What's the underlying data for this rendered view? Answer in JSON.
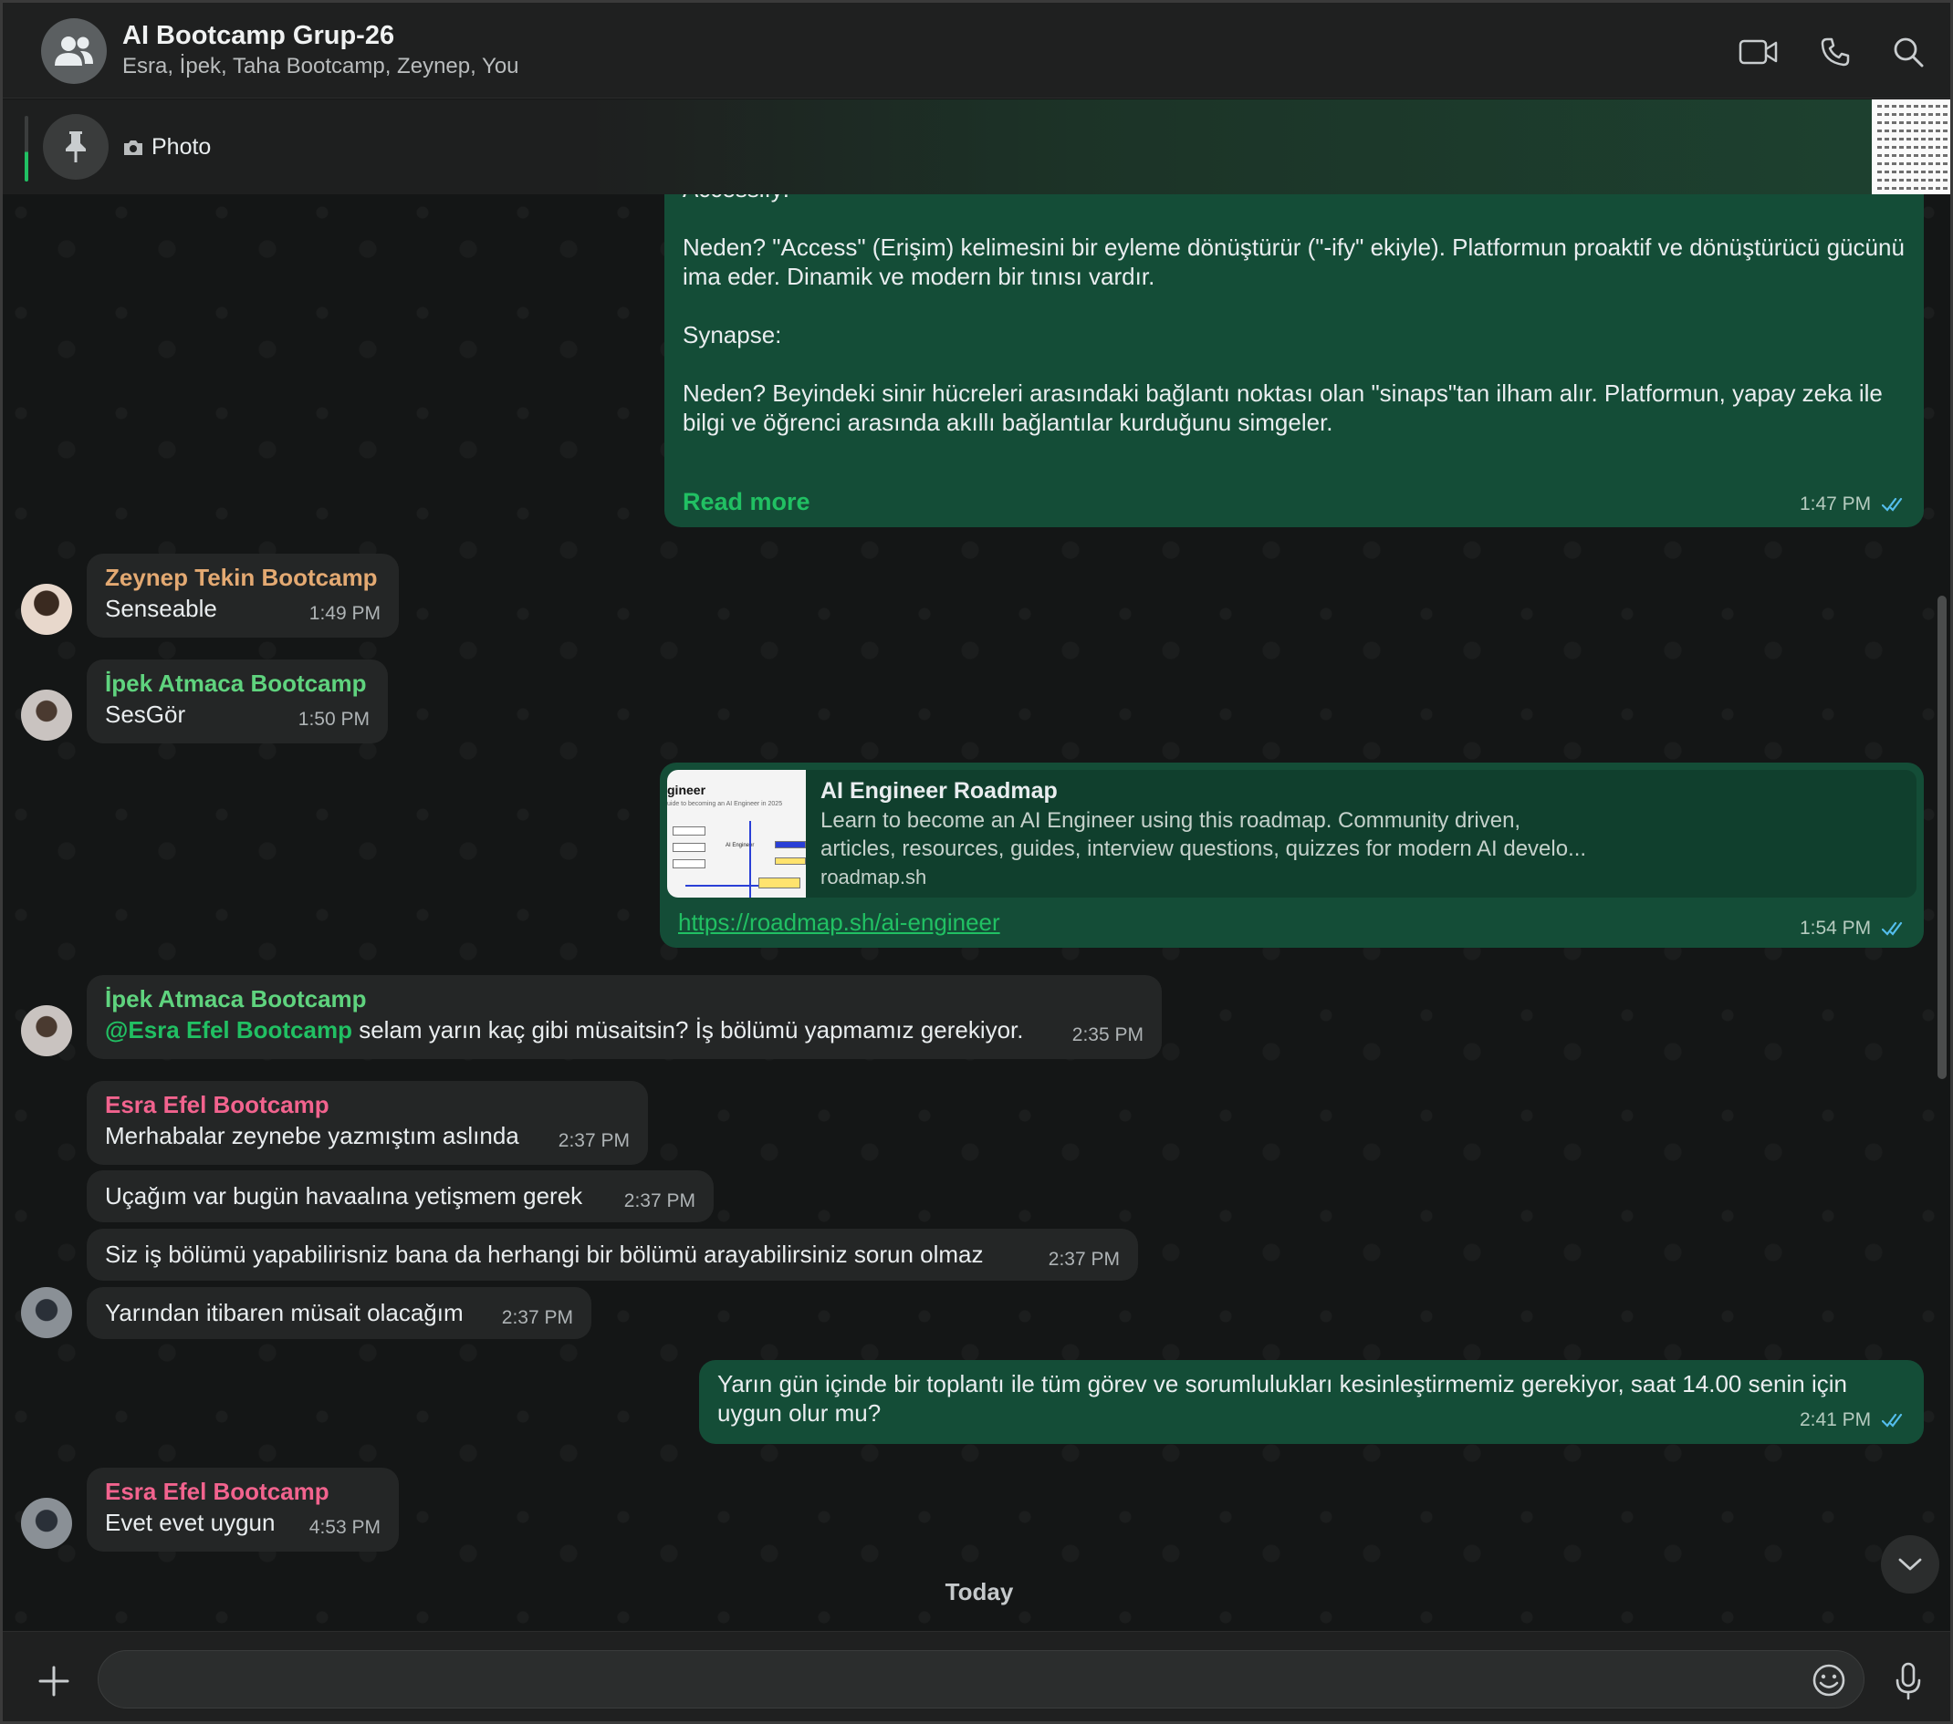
{
  "header": {
    "title": "AI Bootcamp Grup-26",
    "members": "Esra, İpek, Taha Bootcamp, Zeynep, You"
  },
  "pinned": {
    "label": "Photo"
  },
  "messages": {
    "m1": {
      "cut_line": "Accessify:",
      "p1": "Neden? \"Access\" (Erişim) kelimesini bir eyleme dönüştürür (\"-ify\" ekiyle). Platformun proaktif ve dönüştürücü gücünü ima eder. Dinamik ve modern bir tınısı vardır.",
      "p2": "Synapse:",
      "p3": "Neden? Beyindeki sinir hücreleri arasındaki bağlantı noktası olan \"sinaps\"tan ilham alır. Platformun, yapay zeka ile bilgi ve öğrenci arasında akıllı bağlantılar kurduğunu simgeler.",
      "read_more": "Read more",
      "time": "1:47 PM"
    },
    "m2": {
      "sender": "Zeynep Tekin Bootcamp",
      "text": "Senseable",
      "time": "1:49 PM"
    },
    "m3": {
      "sender": "İpek Atmaca Bootcamp",
      "text": "SesGör",
      "time": "1:50 PM"
    },
    "m4": {
      "thumb_title": "gineer",
      "thumb_sub": "uide to becoming an AI Engineer in 2025",
      "thumb_label": "AI Engineer",
      "title": "AI Engineer Roadmap",
      "desc1": "Learn to become an AI Engineer using this roadmap. Community driven,",
      "desc2": "articles, resources, guides, interview questions, quizzes for modern AI develo...",
      "host": "roadmap.sh",
      "url": "https://roadmap.sh/ai-engineer",
      "time": "1:54 PM"
    },
    "m5": {
      "sender": "İpek Atmaca Bootcamp",
      "mention": "@Esra Efel Bootcamp",
      "text": " selam yarın kaç gibi müsaitsin? İş bölümü yapmamız gerekiyor.",
      "time": "2:35 PM"
    },
    "m6": {
      "sender": "Esra Efel Bootcamp",
      "text": "Merhabalar zeynebe yazmıştım aslında",
      "time": "2:37 PM"
    },
    "m7": {
      "text": "Uçağım var bugün havaalına yetişmem gerek",
      "time": "2:37 PM"
    },
    "m8": {
      "text": "Siz iş bölümü yapabilirisniz bana da herhangi bir bölümü arayabilirsiniz sorun olmaz",
      "time": "2:37 PM"
    },
    "m9": {
      "text": "Yarından itibaren müsait olacağım",
      "time": "2:37 PM"
    },
    "m10": {
      "line1": "Yarın gün içinde bir toplantı ile tüm görev ve sorumlulukları kesinleştirmemiz gerekiyor, saat 14.00 senin için",
      "line2": "uygun olur mu?",
      "time": "2:41 PM"
    },
    "m11": {
      "sender": "Esra Efel Bootcamp",
      "text": "Evet evet uygun",
      "time": "4:53 PM"
    }
  },
  "date_divider": "Today",
  "composer": {
    "placeholder": ""
  },
  "colors": {
    "accent_green": "#21c063",
    "outgoing_bubble": "#144d37",
    "incoming_bubble": "#242626",
    "zeynep_name": "#e3a972",
    "ipek_name": "#5fd37e",
    "esra_name": "#f2638e",
    "read_ticks": "#53bdeb"
  },
  "icons": [
    "group-icon",
    "video-call-icon",
    "voice-call-icon",
    "search-icon",
    "pin-icon",
    "camera-icon",
    "double-check-icon",
    "chevron-down-icon",
    "plus-icon",
    "emoji-icon",
    "microphone-icon"
  ]
}
